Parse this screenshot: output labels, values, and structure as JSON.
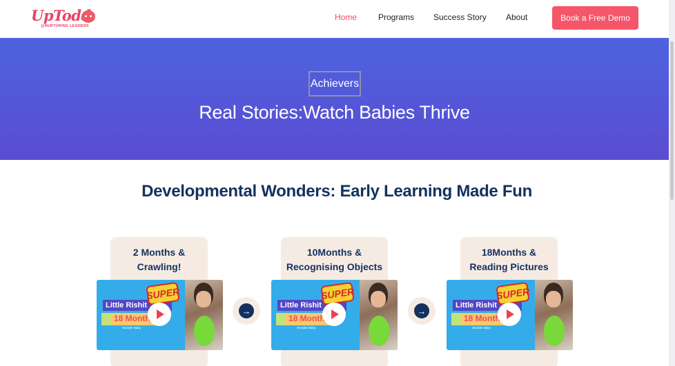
{
  "header": {
    "logo_text": "UpTodd",
    "logo_subtitle": "@NURTURING LEADERS",
    "nav": [
      {
        "label": "Home",
        "active": true
      },
      {
        "label": "Programs",
        "active": false
      },
      {
        "label": "Success Story",
        "active": false
      },
      {
        "label": "About",
        "active": false
      }
    ],
    "cta_label": "Book a Free Demo"
  },
  "hero": {
    "badge": "Achievers",
    "title": "Real Stories:Watch Babies Thrive"
  },
  "section": {
    "title": "Developmental Wonders: Early Learning Made Fun"
  },
  "cards": [
    {
      "title_line1": "2 Months &",
      "title_line2": "Crawling!",
      "video_name": "Little Rishit",
      "video_age": "18 Month",
      "video_caption": "Wonder Baby",
      "badge": "SUPER"
    },
    {
      "title_line1": "10Months &",
      "title_line2": "Recognising Objects",
      "video_name": "Little Rishit",
      "video_age": "18 Month",
      "video_caption": "Wonder Baby",
      "badge": "SUPER"
    },
    {
      "title_line1": "18Months &",
      "title_line2": "Reading Pictures",
      "video_name": "Little Rishit",
      "video_age": "18 Month",
      "video_caption": "Wonder Baby",
      "badge": "SUPER"
    }
  ],
  "icons": {
    "play": "play-icon",
    "arrow": "arrow-right-icon"
  },
  "colors": {
    "brand": "#ef4d5e",
    "cta": "#f5566a",
    "hero_start": "#4d63df",
    "hero_end": "#5b4cd1",
    "heading": "#14305f",
    "card_bg": "#f6ebe2"
  }
}
